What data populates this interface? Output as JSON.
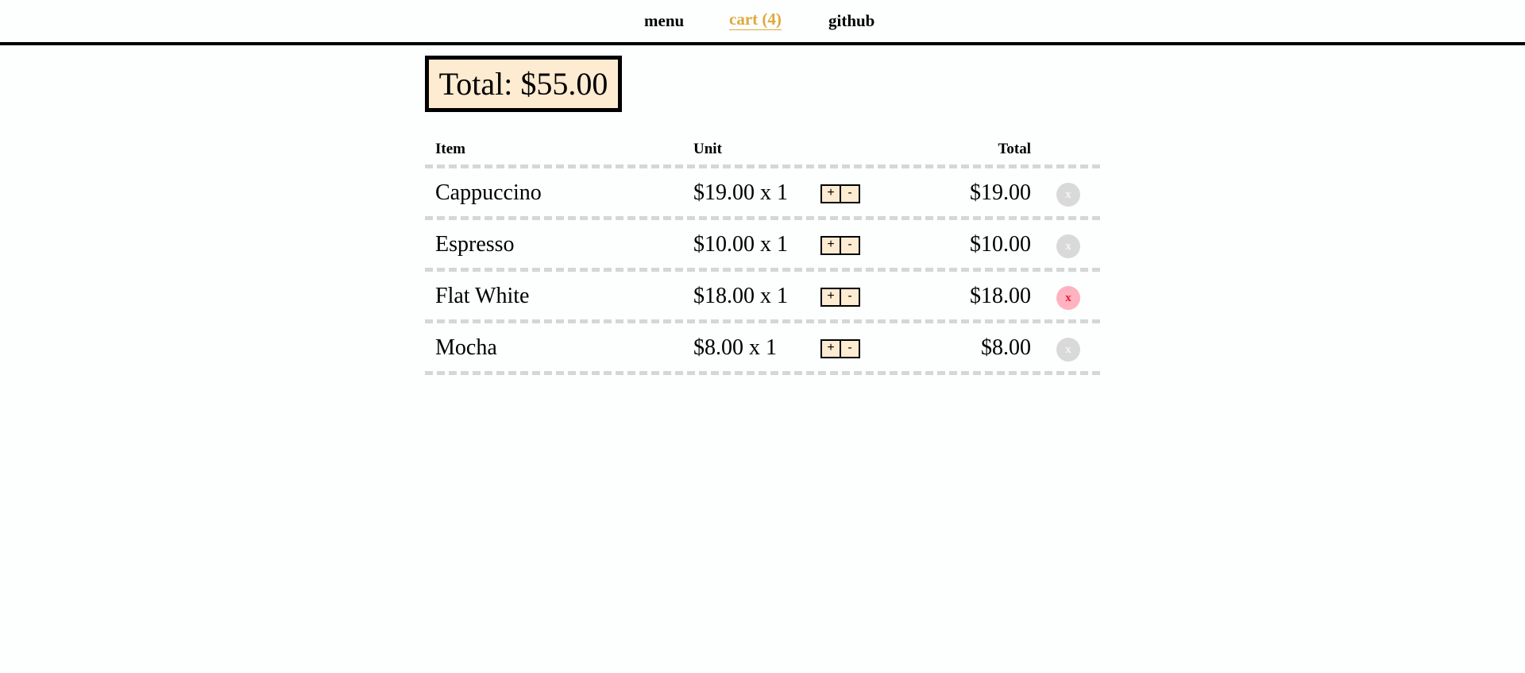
{
  "nav": {
    "menu_label": "menu",
    "cart_label": "cart (4)",
    "github_label": "github"
  },
  "summary": {
    "total_text": "Total: $55.00"
  },
  "table": {
    "headers": {
      "item": "Item",
      "unit": "Unit",
      "total": "Total"
    },
    "rows": [
      {
        "name": "Cappuccino",
        "unit": "$19.00 x 1",
        "plus": "+",
        "minus": "-",
        "total": "$19.00",
        "remove": "x"
      },
      {
        "name": "Espresso",
        "unit": "$10.00 x 1",
        "plus": "+",
        "minus": "-",
        "total": "$10.00",
        "remove": "x"
      },
      {
        "name": "Flat White",
        "unit": "$18.00 x 1",
        "plus": "+",
        "minus": "-",
        "total": "$18.00",
        "remove": "x"
      },
      {
        "name": "Mocha",
        "unit": "$8.00 x 1",
        "plus": "+",
        "minus": "-",
        "total": "$8.00",
        "remove": "x"
      }
    ]
  },
  "colors": {
    "accent": "#e0a83a",
    "cream": "#fdebd2",
    "divider": "#d6d6d6",
    "remove_hover_bg": "#ffb2bf",
    "remove_hover_fg": "#e0203a"
  }
}
